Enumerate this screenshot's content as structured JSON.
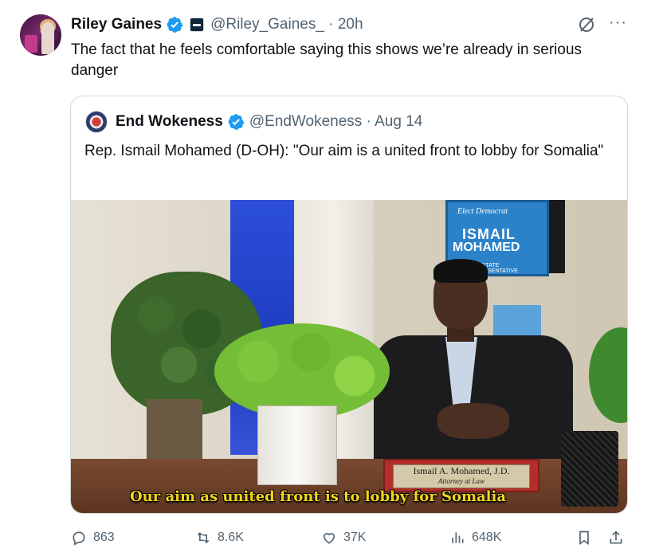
{
  "tweet": {
    "author_name": "Riley Gaines",
    "handle": "@Riley_Gaines_",
    "time": "20h",
    "text": "The fact that he feels comfortable saying this shows we’re already in serious danger"
  },
  "quote": {
    "author_name": "End Wokeness",
    "handle": "@EndWokeness",
    "time": "Aug 14",
    "text": "Rep. Ismail Mohamed (D-OH): \"Our aim is a united front to lobby for Somalia\""
  },
  "media": {
    "caption": "Our aim as united front is to lobby for Somalia",
    "sign_line1": "Elect Democrat",
    "sign_line2": "ISMAIL",
    "sign_line3": "MOHAMED",
    "sign_line4": "FOR STATE REPRESENTATIVE",
    "nameplate_line1": "Ismail A. Mohamed, J.D.",
    "nameplate_line2": "Attorney at Law"
  },
  "actions": {
    "replies": "863",
    "reposts": "8.6K",
    "likes": "37K",
    "views": "648K"
  },
  "colors": {
    "verified_blue": "#1d9bf0",
    "text_secondary": "#536471",
    "border": "#cfd9de",
    "caption_yellow": "#f1d51a"
  },
  "icons": [
    "verified-badge-icon",
    "affiliate-badge-icon",
    "grok-icon",
    "more-icon",
    "reply-icon",
    "repost-icon",
    "like-icon",
    "views-icon",
    "bookmark-icon",
    "share-icon"
  ]
}
